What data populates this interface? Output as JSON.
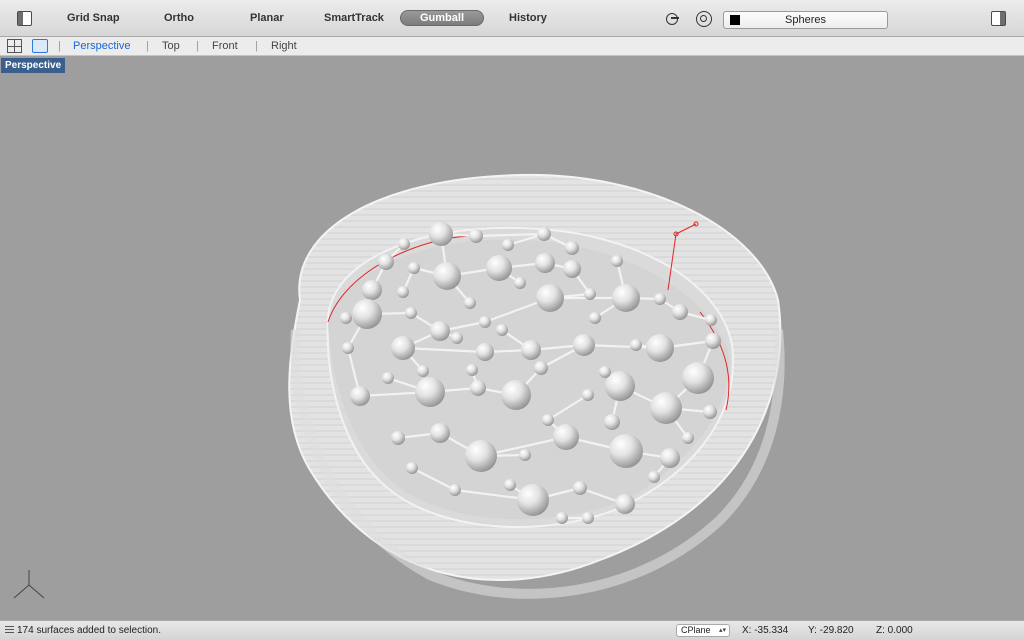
{
  "toolbar": {
    "items": [
      "Grid Snap",
      "Ortho",
      "Planar",
      "SmartTrack",
      "Gumball",
      "History"
    ],
    "active": "Gumball",
    "layer_name": "Spheres",
    "layer_color": "#000000"
  },
  "viewport_tabs": {
    "items": [
      "Perspective",
      "Top",
      "Front",
      "Right"
    ],
    "active": "Perspective"
  },
  "viewport": {
    "label": "Perspective",
    "background": "#9e9e9e",
    "accent": "#e0262a"
  },
  "status": {
    "message": "174 surfaces added to selection.",
    "cplane": "CPlane",
    "x": "X: -35.334",
    "y": "Y: -29.820",
    "z": "Z: 0.000"
  }
}
